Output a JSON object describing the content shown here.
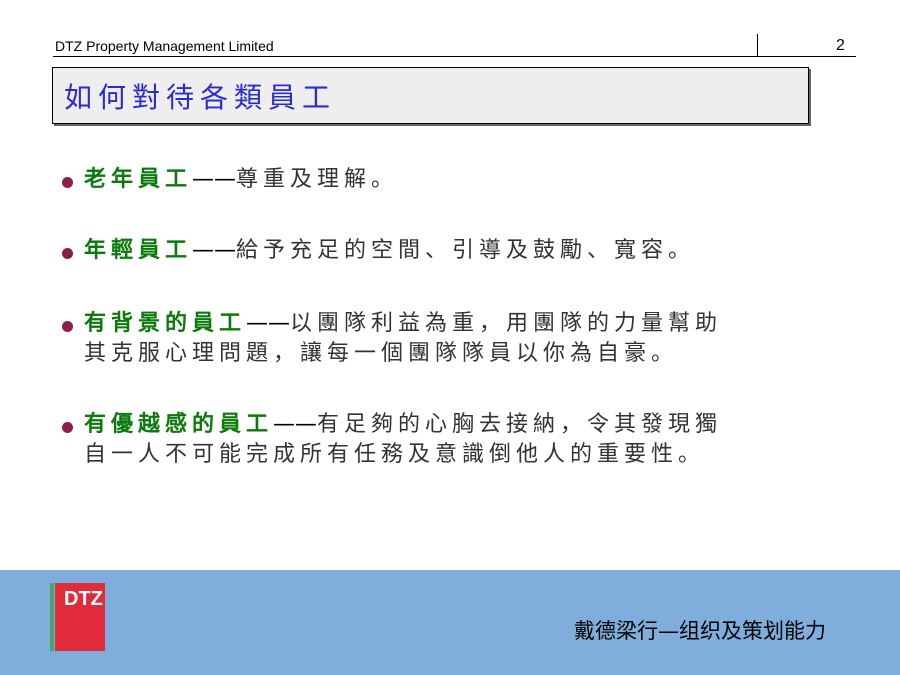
{
  "header": {
    "company": "DTZ Property Management Limited",
    "page_number": "2"
  },
  "title": "如何對待各類員工",
  "dash": "——",
  "bullets": [
    {
      "keyword": "老年員工",
      "line1": "尊重及理解。",
      "line2": ""
    },
    {
      "keyword": "年輕員工",
      "line1": "給予充足的空間、引導及鼓勵、寬容。",
      "line2": ""
    },
    {
      "keyword": "有背景的員工",
      "line1": "以團隊利益為重，用團隊的力量幫助",
      "line2": "其克服心理問題，讓每一個團隊隊員以你為自豪。"
    },
    {
      "keyword": "有優越感的員工",
      "line1": "有足夠的心胸去接納，令其發現獨",
      "line2": "自一人不可能完成所有任務及意識倒他人的重要性。"
    }
  ],
  "footer": {
    "logo_text": "DTZ",
    "tagline": "戴德梁行—组织及策划能力"
  },
  "colors": {
    "title": "#2b2bd4",
    "keyword": "#0a7a0a",
    "bullet_dot": "#8b1f4a",
    "footer_band": "#7faedc",
    "logo_red": "#e02b3a",
    "logo_green": "#4aa36b"
  }
}
